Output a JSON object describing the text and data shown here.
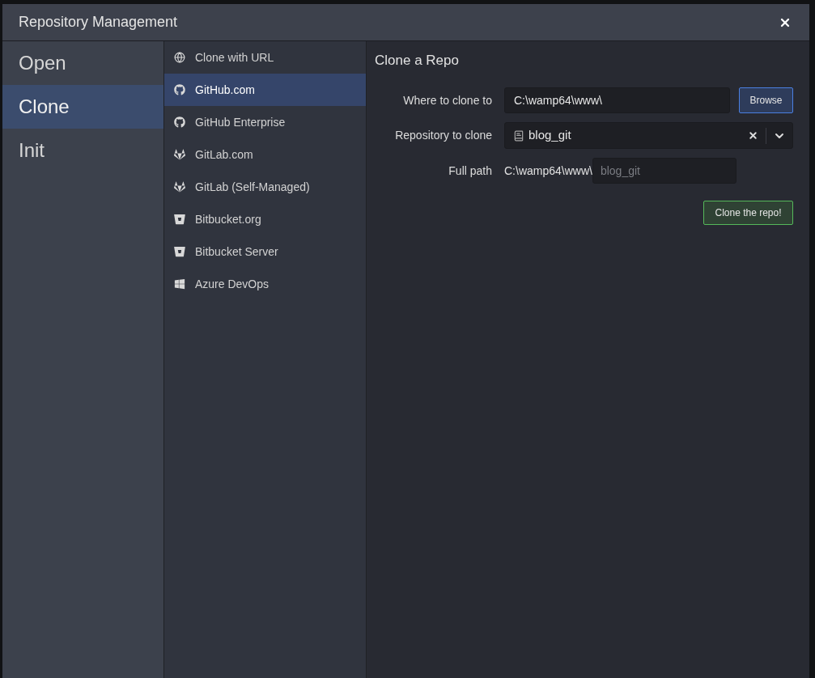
{
  "window": {
    "title": "Repository Management"
  },
  "modes": [
    {
      "label": "Open",
      "selected": false
    },
    {
      "label": "Clone",
      "selected": true
    },
    {
      "label": "Init",
      "selected": false
    }
  ],
  "sources": [
    {
      "label": "Clone with URL",
      "kind": "globe",
      "selected": false
    },
    {
      "label": "GitHub.com",
      "kind": "github",
      "selected": true
    },
    {
      "label": "GitHub Enterprise",
      "kind": "github",
      "selected": false
    },
    {
      "label": "GitLab.com",
      "kind": "gitlab",
      "selected": false
    },
    {
      "label": "GitLab (Self-Managed)",
      "kind": "gitlab",
      "selected": false
    },
    {
      "label": "Bitbucket.org",
      "kind": "bitbucket",
      "selected": false
    },
    {
      "label": "Bitbucket Server",
      "kind": "bitbucket",
      "selected": false
    },
    {
      "label": "Azure DevOps",
      "kind": "windows",
      "selected": false
    }
  ],
  "form": {
    "heading": "Clone a Repo",
    "destination": {
      "label": "Where to clone to",
      "value": "C:\\wamp64\\www\\",
      "button": "Browse"
    },
    "repository": {
      "label": "Repository to clone",
      "value": "blog_git"
    },
    "full_path": {
      "label": "Full path",
      "prefix": "C:\\wamp64\\www\\",
      "placeholder": "blog_git"
    },
    "submit": "Clone the repo!"
  }
}
